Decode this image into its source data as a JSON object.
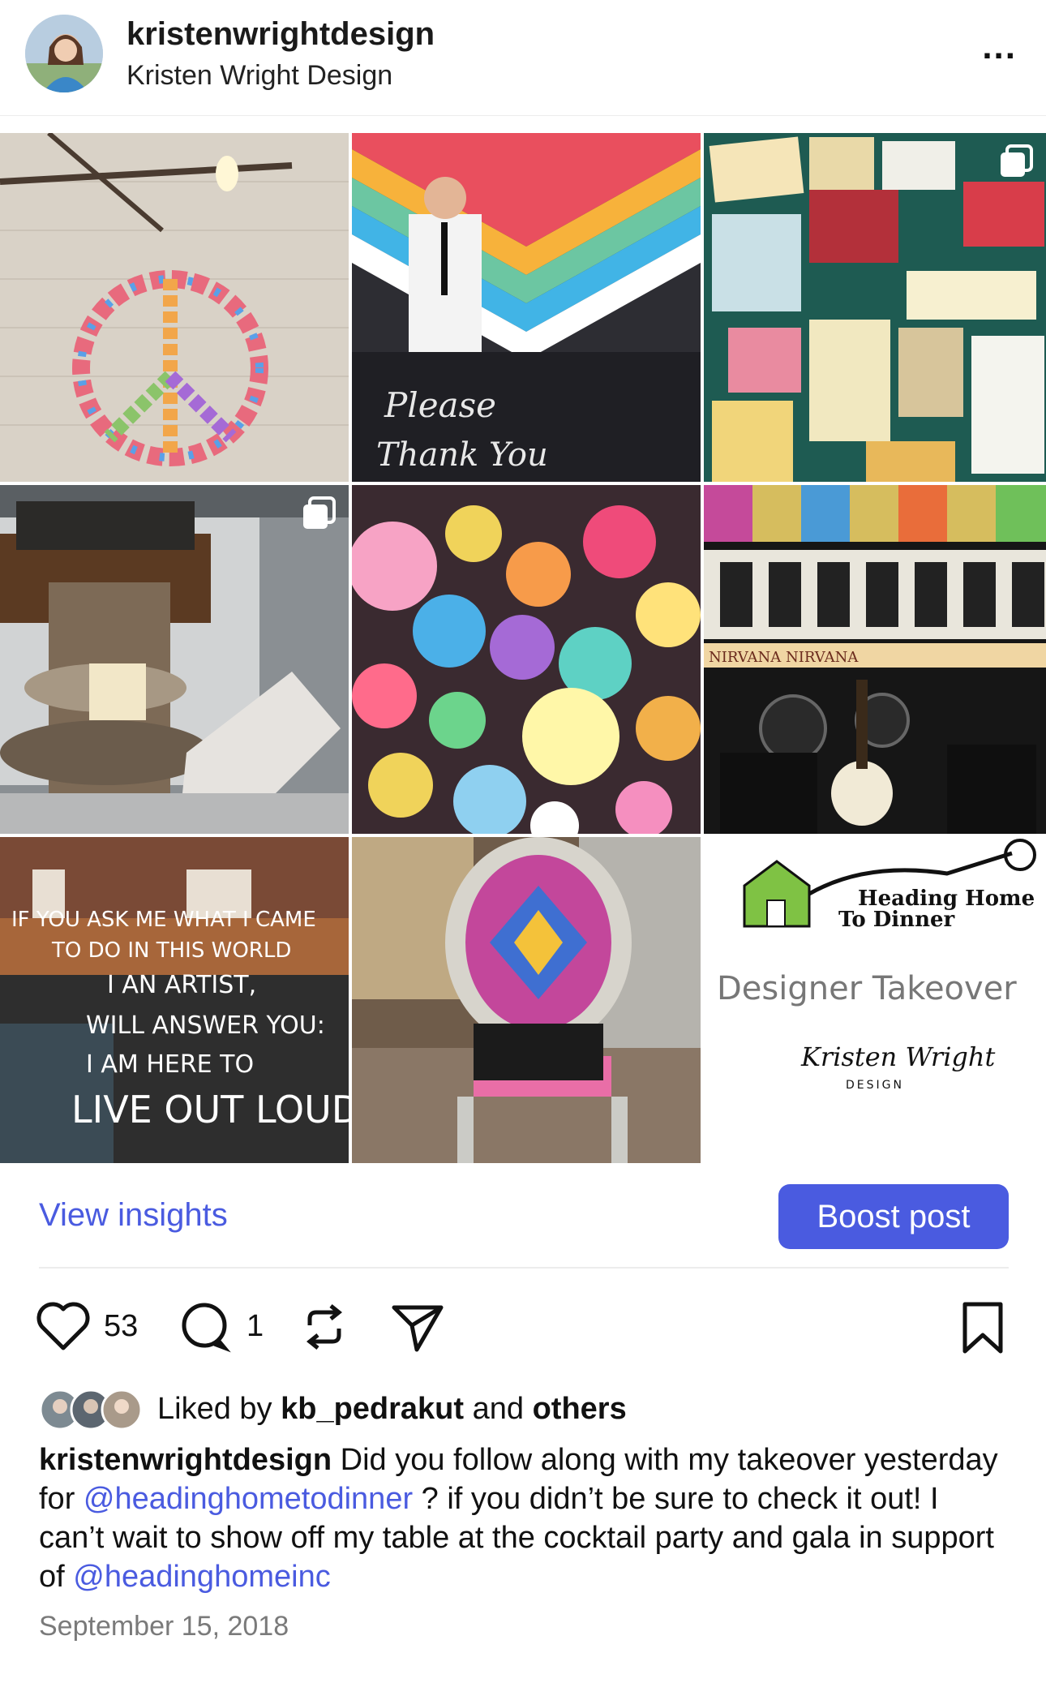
{
  "header": {
    "username": "kristenwrightdesign",
    "full_name": "Kristen Wright Design",
    "more_icon": "ellipsis-icon",
    "more_label": "..."
  },
  "grid": {
    "tiles": [
      {
        "name": "peace-sign-wall",
        "colors": [
          "#d9d4cc",
          "#ffffff"
        ]
      },
      {
        "name": "please-thank-you-bar",
        "text_line1": "Please",
        "text_line2": "Thank You"
      },
      {
        "name": "concert-tickets-collage",
        "has_multi_icon": true
      },
      {
        "name": "vinyl-records-table",
        "has_multi_icon": true
      },
      {
        "name": "rainbow-balloons"
      },
      {
        "name": "nirvana-jimi-stage",
        "banner": "NIRVANA NIRVANA"
      },
      {
        "name": "live-out-loud-quote",
        "lines": [
          "IF YOU ASK ME WHAT I CAME",
          "TO DO IN THIS WORLD",
          "I AN ARTIST,",
          "WILL ANSWER YOU:",
          "I AM HERE TO",
          "LIVE OUT LOUD"
        ]
      },
      {
        "name": "colorful-chair"
      },
      {
        "name": "designer-takeover-card",
        "brand_line1": "Heading Home",
        "brand_line2": "To Dinner",
        "title": "Designer Takeover",
        "signature": "Kristen Wright",
        "signature_sub": "DESIGN"
      }
    ]
  },
  "actions": {
    "view_insights": "View insights",
    "boost_post": "Boost post"
  },
  "engagement": {
    "like_count": "53",
    "comment_count": "1",
    "icons": [
      "heart-icon",
      "comment-icon",
      "repost-icon",
      "send-icon",
      "bookmark-icon"
    ]
  },
  "likes": {
    "prefix": "Liked by ",
    "user": "kb_pedrakut",
    "middle": " and ",
    "others": "others"
  },
  "caption": {
    "author": "kristenwrightdesign",
    "part1": " Did you follow along with my takeover yesterday for ",
    "mention1": "@headinghometodinner",
    "part2": " ? if you didn’t be sure to check it out! I can’t wait to show off my table at the cocktail party and gala in support of ",
    "mention2": "@headinghomeinc"
  },
  "date": "September 15, 2018",
  "colors": {
    "accent": "#4a5be0",
    "divider": "#ececec",
    "muted": "#7a7a7a"
  }
}
